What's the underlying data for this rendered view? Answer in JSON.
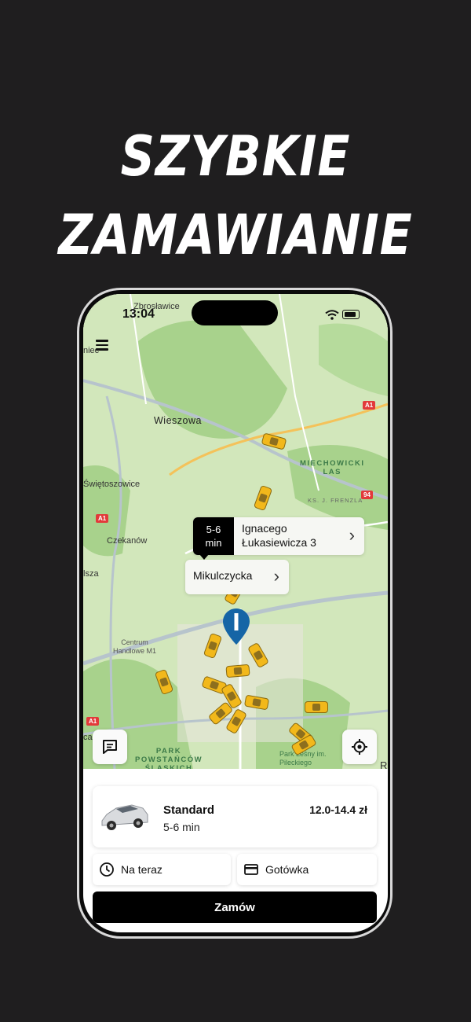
{
  "promo": {
    "line1": "SZYBKIE",
    "line2": "ZAMAWIANIE"
  },
  "status_bar": {
    "time": "13:04"
  },
  "map": {
    "labels": {
      "zbroslawice": "Zbrosławice",
      "niec": "niec",
      "wieszowa": "Wieszowa",
      "miechowicki_las": "MIECHOWICKI\nLAS",
      "swietoszowice": "Świętoszowice",
      "ks_frenzla": "KS. J. FRENZLA",
      "czekanow": "Czekanów",
      "isza": "lsza",
      "centrum": "Centrum\nHandlowe M1",
      "park": "PARK\nPOWSTAŃCÓW\nŚLĄSKICH",
      "park_lesny": "Park Leśny im.\nPileckiego",
      "ca": "ca",
      "r": "R"
    },
    "road_signs": {
      "a1_top": "A1",
      "a1_left": "A1",
      "a1_bottom": "A1",
      "r94": "94"
    },
    "pickup": {
      "eta": "5-6\nmin",
      "address": "Ignacego\nŁukasiewicza 3"
    },
    "destination": {
      "address": "Mikulczycka"
    },
    "colors": {
      "pin": "#1565a6",
      "taxi": "#f2b81b"
    }
  },
  "ride": {
    "name": "Standard",
    "eta": "5-6 min",
    "price": "12.0-14.4 zł"
  },
  "options": {
    "time": "Na teraz",
    "payment": "Gotówka"
  },
  "order_button": "Zamów"
}
